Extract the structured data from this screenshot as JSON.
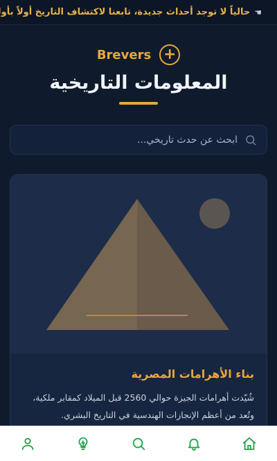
{
  "ticker": {
    "hand_icon": "hand-pointing-icon",
    "text": "حالياً لا توجد أحداث جديدة، تابعنا لاكتشاف التاريخ أولاً بأول"
  },
  "brand": {
    "name": "Brevers",
    "icon": "plus-circle-icon",
    "accent": "#e8a83a"
  },
  "page": {
    "title": "المعلومات التاريخية"
  },
  "search": {
    "placeholder": "ابحث عن حدث تاريخي...",
    "icon": "search-icon"
  },
  "card": {
    "image": "pyramid-illustration",
    "title": "بناء الأهرامات المصرية",
    "description": "شُيّدت أهرامات الجيزة حوالي 2560 قبل الميلاد كمقابر ملكية، وتُعد من أعظم الإنجازات الهندسية في التاريخ البشري."
  },
  "nav": {
    "items": [
      {
        "name": "profile",
        "icon": "user-icon"
      },
      {
        "name": "ideas",
        "icon": "lightbulb-icon"
      },
      {
        "name": "search",
        "icon": "search-icon"
      },
      {
        "name": "notifications",
        "icon": "bell-icon"
      },
      {
        "name": "home",
        "icon": "home-icon"
      }
    ],
    "active_color": "#22a34a"
  }
}
